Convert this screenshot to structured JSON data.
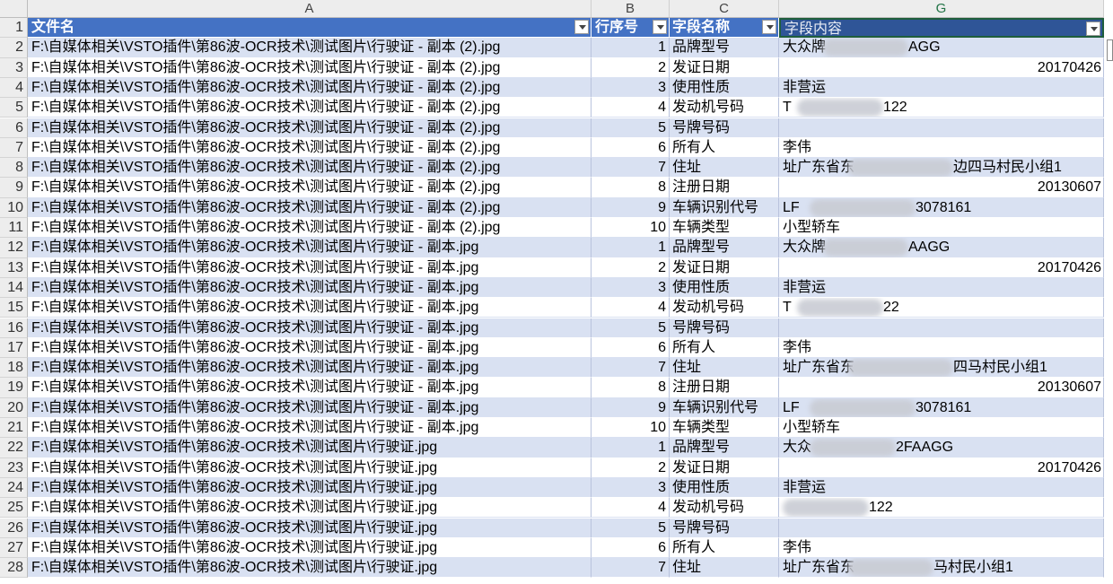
{
  "columns": {
    "corner": "",
    "A": "A",
    "B": "B",
    "C": "C",
    "G": "G"
  },
  "header": {
    "row_num": "1",
    "a": "文件名",
    "b": "行序号",
    "c": "字段名称",
    "g": "字段内容"
  },
  "rows": [
    {
      "n": "2",
      "a": "F:\\自媒体相关\\VSTO插件\\第86波-OCR技术\\测试图片\\行驶证 - 副本 (2).jpg",
      "b": "1",
      "c": "品牌型号",
      "g": "大众牌",
      "g2": "AGG",
      "num": ""
    },
    {
      "n": "3",
      "a": "F:\\自媒体相关\\VSTO插件\\第86波-OCR技术\\测试图片\\行驶证 - 副本 (2).jpg",
      "b": "2",
      "c": "发证日期",
      "g": "",
      "g2": "",
      "num": "20170426"
    },
    {
      "n": "4",
      "a": "F:\\自媒体相关\\VSTO插件\\第86波-OCR技术\\测试图片\\行驶证 - 副本 (2).jpg",
      "b": "3",
      "c": "使用性质",
      "g": "非营运",
      "g2": "",
      "num": ""
    },
    {
      "n": "5",
      "a": "F:\\自媒体相关\\VSTO插件\\第86波-OCR技术\\测试图片\\行驶证 - 副本 (2).jpg",
      "b": "4",
      "c": "发动机号码",
      "g": "T",
      "g2": "122",
      "num": ""
    },
    {
      "n": "6",
      "a": "F:\\自媒体相关\\VSTO插件\\第86波-OCR技术\\测试图片\\行驶证 - 副本 (2).jpg",
      "b": "5",
      "c": "号牌号码",
      "g": "",
      "g2": "",
      "num": ""
    },
    {
      "n": "7",
      "a": "F:\\自媒体相关\\VSTO插件\\第86波-OCR技术\\测试图片\\行驶证 - 副本 (2).jpg",
      "b": "6",
      "c": "所有人",
      "g": "李伟",
      "g2": "",
      "num": ""
    },
    {
      "n": "8",
      "a": "F:\\自媒体相关\\VSTO插件\\第86波-OCR技术\\测试图片\\行驶证 - 副本 (2).jpg",
      "b": "7",
      "c": "住址",
      "g": "址广东省东",
      "g2": "边四马村民小组1",
      "num": ""
    },
    {
      "n": "9",
      "a": "F:\\自媒体相关\\VSTO插件\\第86波-OCR技术\\测试图片\\行驶证 - 副本 (2).jpg",
      "b": "8",
      "c": "注册日期",
      "g": "",
      "g2": "",
      "num": "20130607"
    },
    {
      "n": "10",
      "a": "F:\\自媒体相关\\VSTO插件\\第86波-OCR技术\\测试图片\\行驶证 - 副本 (2).jpg",
      "b": "9",
      "c": "车辆识别代号",
      "g": "LF",
      "g2": "3078161",
      "num": ""
    },
    {
      "n": "11",
      "a": "F:\\自媒体相关\\VSTO插件\\第86波-OCR技术\\测试图片\\行驶证 - 副本 (2).jpg",
      "b": "10",
      "c": "车辆类型",
      "g": "小型轿车",
      "g2": "",
      "num": ""
    },
    {
      "n": "12",
      "a": "F:\\自媒体相关\\VSTO插件\\第86波-OCR技术\\测试图片\\行驶证 - 副本.jpg",
      "b": "1",
      "c": "品牌型号",
      "g": "大众牌",
      "g2": "AAGG",
      "num": ""
    },
    {
      "n": "13",
      "a": "F:\\自媒体相关\\VSTO插件\\第86波-OCR技术\\测试图片\\行驶证 - 副本.jpg",
      "b": "2",
      "c": "发证日期",
      "g": "",
      "g2": "",
      "num": "20170426"
    },
    {
      "n": "14",
      "a": "F:\\自媒体相关\\VSTO插件\\第86波-OCR技术\\测试图片\\行驶证 - 副本.jpg",
      "b": "3",
      "c": "使用性质",
      "g": "非营运",
      "g2": "",
      "num": ""
    },
    {
      "n": "15",
      "a": "F:\\自媒体相关\\VSTO插件\\第86波-OCR技术\\测试图片\\行驶证 - 副本.jpg",
      "b": "4",
      "c": "发动机号码",
      "g": "T",
      "g2": "22",
      "num": ""
    },
    {
      "n": "16",
      "a": "F:\\自媒体相关\\VSTO插件\\第86波-OCR技术\\测试图片\\行驶证 - 副本.jpg",
      "b": "5",
      "c": "号牌号码",
      "g": "",
      "g2": "",
      "num": ""
    },
    {
      "n": "17",
      "a": "F:\\自媒体相关\\VSTO插件\\第86波-OCR技术\\测试图片\\行驶证 - 副本.jpg",
      "b": "6",
      "c": "所有人",
      "g": "李伟",
      "g2": "",
      "num": ""
    },
    {
      "n": "18",
      "a": "F:\\自媒体相关\\VSTO插件\\第86波-OCR技术\\测试图片\\行驶证 - 副本.jpg",
      "b": "7",
      "c": "住址",
      "g": "址广东省东",
      "g2": "四马村民小组1",
      "num": ""
    },
    {
      "n": "19",
      "a": "F:\\自媒体相关\\VSTO插件\\第86波-OCR技术\\测试图片\\行驶证 - 副本.jpg",
      "b": "8",
      "c": "注册日期",
      "g": "",
      "g2": "",
      "num": "20130607"
    },
    {
      "n": "20",
      "a": "F:\\自媒体相关\\VSTO插件\\第86波-OCR技术\\测试图片\\行驶证 - 副本.jpg",
      "b": "9",
      "c": "车辆识别代号",
      "g": "LF",
      "g2": "3078161",
      "num": ""
    },
    {
      "n": "21",
      "a": "F:\\自媒体相关\\VSTO插件\\第86波-OCR技术\\测试图片\\行驶证 - 副本.jpg",
      "b": "10",
      "c": "车辆类型",
      "g": "小型轿车",
      "g2": "",
      "num": ""
    },
    {
      "n": "22",
      "a": "F:\\自媒体相关\\VSTO插件\\第86波-OCR技术\\测试图片\\行驶证.jpg",
      "b": "1",
      "c": "品牌型号",
      "g": "大众",
      "g2": "2FAAGG",
      "num": ""
    },
    {
      "n": "23",
      "a": "F:\\自媒体相关\\VSTO插件\\第86波-OCR技术\\测试图片\\行驶证.jpg",
      "b": "2",
      "c": "发证日期",
      "g": "",
      "g2": "",
      "num": "20170426"
    },
    {
      "n": "24",
      "a": "F:\\自媒体相关\\VSTO插件\\第86波-OCR技术\\测试图片\\行驶证.jpg",
      "b": "3",
      "c": "使用性质",
      "g": "非营运",
      "g2": "",
      "num": ""
    },
    {
      "n": "25",
      "a": "F:\\自媒体相关\\VSTO插件\\第86波-OCR技术\\测试图片\\行驶证.jpg",
      "b": "4",
      "c": "发动机号码",
      "g": "",
      "g2": "122",
      "num": ""
    },
    {
      "n": "26",
      "a": "F:\\自媒体相关\\VSTO插件\\第86波-OCR技术\\测试图片\\行驶证.jpg",
      "b": "5",
      "c": "号牌号码",
      "g": "",
      "g2": "",
      "num": ""
    },
    {
      "n": "27",
      "a": "F:\\自媒体相关\\VSTO插件\\第86波-OCR技术\\测试图片\\行驶证.jpg",
      "b": "6",
      "c": "所有人",
      "g": "李伟",
      "g2": "",
      "num": ""
    },
    {
      "n": "28",
      "a": "F:\\自媒体相关\\VSTO插件\\第86波-OCR技术\\测试图片\\行驶证.jpg",
      "b": "7",
      "c": "住址",
      "g": "址广东省东",
      "g2": "马村民小组1",
      "num": ""
    }
  ],
  "colors": {
    "header_bg": "#4472c4",
    "band_bg": "#d9e1f2",
    "selected_header": "#2f5597"
  }
}
